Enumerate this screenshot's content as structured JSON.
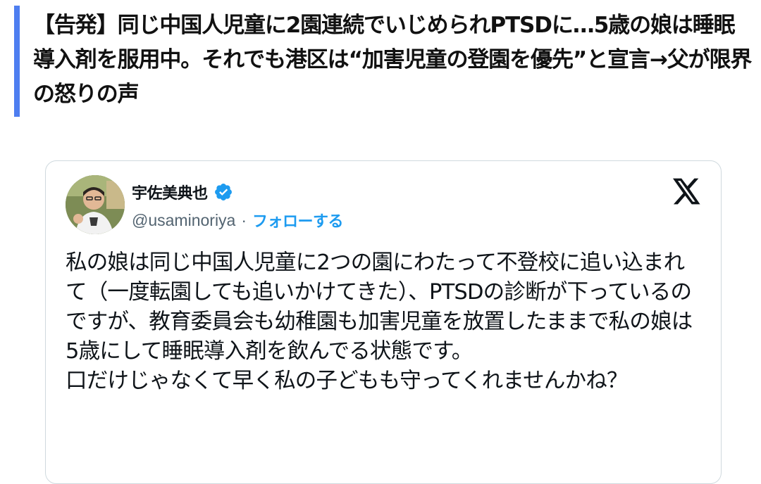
{
  "article": {
    "headline": "【告発】同じ中国人児童に2園連続でいじめられPTSDに…5歳の娘は睡眠導入剤を服用中。それでも港区は“加害児童の登園を優先”と宣言→父が限界の怒りの声",
    "accent_color": "#4e7ef0"
  },
  "tweet": {
    "author": {
      "display_name": "宇佐美典也",
      "handle": "@usaminoriya",
      "verified": true,
      "verified_icon": "verified-badge-icon"
    },
    "separator": "·",
    "follow_label": "フォローする",
    "platform_icon": "x-logo-icon",
    "text": "私の娘は同じ中国人児童に2つの園にわたって不登校に追い込まれて（一度転園しても追いかけてきた）、PTSDの診断が下っているのですが、教育委員会も幼稚園も加害児童を放置したままで私の娘は5歳にして睡眠導入剤を飲んでる状態です。\n口だけじゃなくて早く私の子どもも守ってくれませんかね？",
    "colors": {
      "link": "#1d9bf0",
      "border": "#cfd9de",
      "secondary_text": "#536471"
    }
  }
}
